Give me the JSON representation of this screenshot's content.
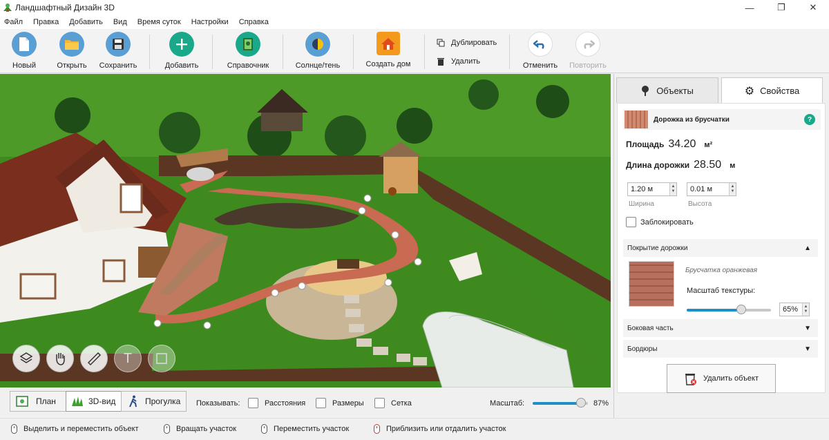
{
  "window": {
    "title": "Ландшафтный Дизайн 3D",
    "minimize": "—",
    "maximize": "❐",
    "close": "✕"
  },
  "menu": [
    "Файл",
    "Правка",
    "Добавить",
    "Вид",
    "Время суток",
    "Настройки",
    "Справка"
  ],
  "toolbar": {
    "new": "Новый",
    "open": "Открыть",
    "save": "Сохранить",
    "add": "Добавить",
    "reference": "Справочник",
    "sun": "Солнце/тень",
    "create_house": "Создать дом",
    "duplicate": "Дублировать",
    "delete": "Удалить",
    "undo": "Отменить",
    "redo": "Повторить"
  },
  "panel": {
    "tab_objects": "Объекты",
    "tab_properties": "Свойства",
    "object_title": "Дорожка из брусчатки",
    "help": "?",
    "area_label": "Площадь",
    "area_value": "34.20",
    "area_unit": "м²",
    "length_label": "Длина дорожки",
    "length_value": "28.50",
    "length_unit": "м",
    "width_value": "1.20 м",
    "width_label": "Ширина",
    "height_value": "0.01 м",
    "height_label": "Высота",
    "lock_label": "Заблокировать",
    "cover_header": "Покрытие дорожки",
    "texture_name": "Брусчатка оранжевая",
    "texture_scale_label": "Масштаб текстуры:",
    "texture_scale_value": "65%",
    "texture_scale": 0.65,
    "side_header": "Боковая часть",
    "border_header": "Бордюры",
    "delete_button": "Удалить объект"
  },
  "viewbar": {
    "plan": "План",
    "view3d": "3D-вид",
    "walk": "Прогулка",
    "show_label": "Показывать:",
    "distances": "Расстояния",
    "sizes": "Размеры",
    "grid": "Сетка",
    "scale_label": "Масштаб:",
    "scale_value": "87%",
    "scale": 0.87
  },
  "status": {
    "s1": "Выделить и переместить объект",
    "s2": "Вращать участок",
    "s3": "Переместить участок",
    "s4": "Приблизить или отдалить участок"
  },
  "colors": {
    "accent": "#1e90c8",
    "grass": "#3f8a20",
    "path": "#c0644e",
    "tab_active": "#ffffff"
  }
}
